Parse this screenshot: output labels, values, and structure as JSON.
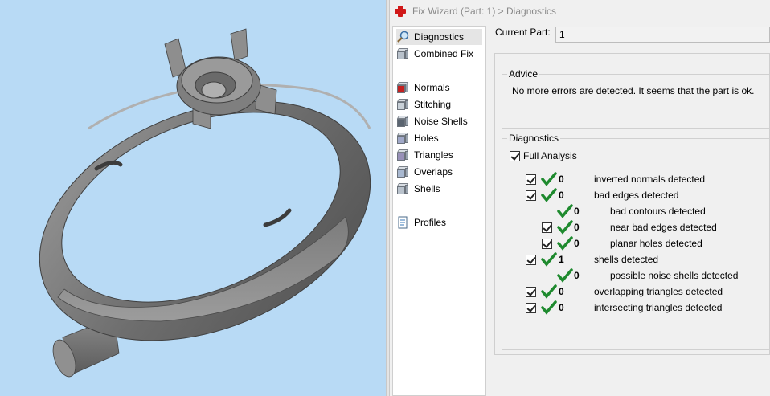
{
  "title": "Fix Wizard (Part: 1) > Diagnostics",
  "nav": {
    "items": [
      {
        "label": "Diagnostics",
        "icon": "magnifier-icon"
      },
      {
        "label": "Combined Fix",
        "icon": "cube-icon"
      },
      {
        "label": "Normals",
        "icon": "normals-cube-icon"
      },
      {
        "label": "Stitching",
        "icon": "stitching-icon"
      },
      {
        "label": "Noise Shells",
        "icon": "noise-shells-icon"
      },
      {
        "label": "Holes",
        "icon": "holes-icon"
      },
      {
        "label": "Triangles",
        "icon": "triangles-icon"
      },
      {
        "label": "Overlaps",
        "icon": "overlaps-icon"
      },
      {
        "label": "Shells",
        "icon": "shells-icon"
      },
      {
        "label": "Profiles",
        "icon": "profile-document-icon"
      }
    ]
  },
  "current_part": {
    "label": "Current Part:",
    "value": "1"
  },
  "advice": {
    "title": "Advice",
    "text": "No more errors are detected. It seems that the part is ok."
  },
  "diagnostics": {
    "title": "Diagnostics",
    "full_analysis": "Full Analysis",
    "rows": [
      {
        "count": "0",
        "label": "inverted normals detected",
        "checkbox": true,
        "indent": 0
      },
      {
        "count": "0",
        "label": "bad edges detected",
        "checkbox": true,
        "indent": 0
      },
      {
        "count": "0",
        "label": "bad contours detected",
        "checkbox": false,
        "indent": 1
      },
      {
        "count": "0",
        "label": "near bad edges detected",
        "checkbox": true,
        "indent": 1
      },
      {
        "count": "0",
        "label": "planar holes detected",
        "checkbox": true,
        "indent": 1
      },
      {
        "count": "1",
        "label": "shells detected",
        "checkbox": true,
        "indent": 0
      },
      {
        "count": "0",
        "label": "possible noise shells detected",
        "checkbox": false,
        "indent": 1
      },
      {
        "count": "0",
        "label": "overlapping triangles detected",
        "checkbox": true,
        "indent": 0
      },
      {
        "count": "0",
        "label": "intersecting triangles detected",
        "checkbox": true,
        "indent": 0
      }
    ]
  },
  "colors": {
    "viewport_bg": "#b8daf5",
    "tick_green": "#1e8a2e",
    "app_icon_red": "#d01818"
  }
}
